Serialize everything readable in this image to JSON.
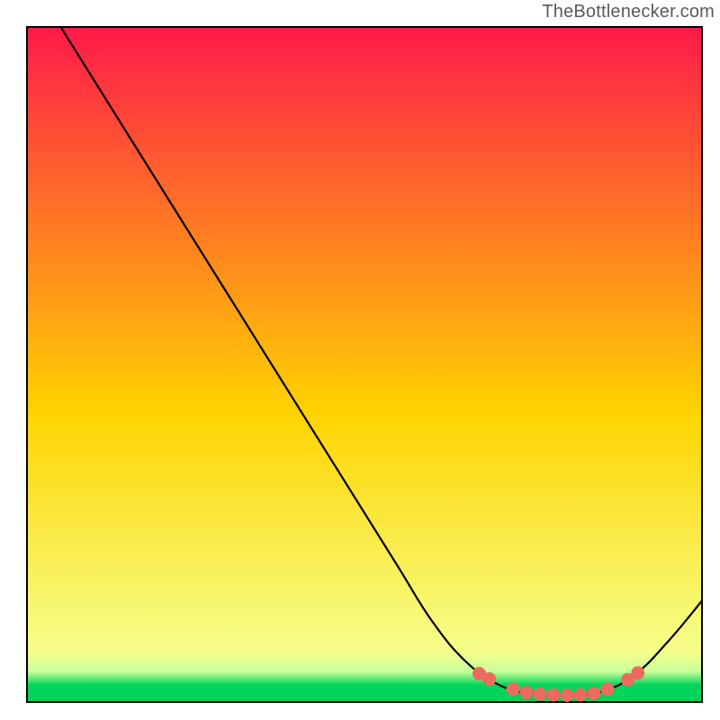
{
  "watermark": "TheBottlenecker.com",
  "chart_data": {
    "type": "line",
    "title": "",
    "xlabel": "",
    "ylabel": "",
    "xlim": [
      0,
      100
    ],
    "ylim": [
      0,
      100
    ],
    "grid": false,
    "legend": false,
    "gradient": {
      "top_color": "#ff1a4a",
      "mid_color": "#ffd400",
      "bottom_color": "#00d45a",
      "green_band_top_frac": 0.955,
      "green_band_mid_frac": 0.975
    },
    "curve": {
      "description": "V-shaped bottleneck curve; steep linear descent from top-left, flat trough around x≈80, rise toward right edge",
      "points": [
        {
          "x": 5,
          "y": 100
        },
        {
          "x": 10,
          "y": 92
        },
        {
          "x": 15,
          "y": 84
        },
        {
          "x": 20,
          "y": 76
        },
        {
          "x": 25,
          "y": 68
        },
        {
          "x": 30,
          "y": 60
        },
        {
          "x": 35,
          "y": 52
        },
        {
          "x": 40,
          "y": 44
        },
        {
          "x": 45,
          "y": 36
        },
        {
          "x": 50,
          "y": 28
        },
        {
          "x": 55,
          "y": 20
        },
        {
          "x": 60,
          "y": 12
        },
        {
          "x": 65,
          "y": 6
        },
        {
          "x": 70,
          "y": 2.5
        },
        {
          "x": 75,
          "y": 1.2
        },
        {
          "x": 80,
          "y": 1.0
        },
        {
          "x": 85,
          "y": 1.5
        },
        {
          "x": 90,
          "y": 4
        },
        {
          "x": 95,
          "y": 9
        },
        {
          "x": 100,
          "y": 15
        }
      ]
    },
    "markers": {
      "color": "#ec6b5e",
      "points": [
        {
          "x": 67,
          "y": 4.2
        },
        {
          "x": 68.5,
          "y": 3.4
        },
        {
          "x": 72,
          "y": 1.9
        },
        {
          "x": 74,
          "y": 1.4
        },
        {
          "x": 76,
          "y": 1.15
        },
        {
          "x": 78,
          "y": 1.05
        },
        {
          "x": 80,
          "y": 1.0
        },
        {
          "x": 82,
          "y": 1.05
        },
        {
          "x": 84,
          "y": 1.3
        },
        {
          "x": 86,
          "y": 1.9
        },
        {
          "x": 89,
          "y": 3.3
        },
        {
          "x": 90.5,
          "y": 4.3
        }
      ]
    }
  }
}
